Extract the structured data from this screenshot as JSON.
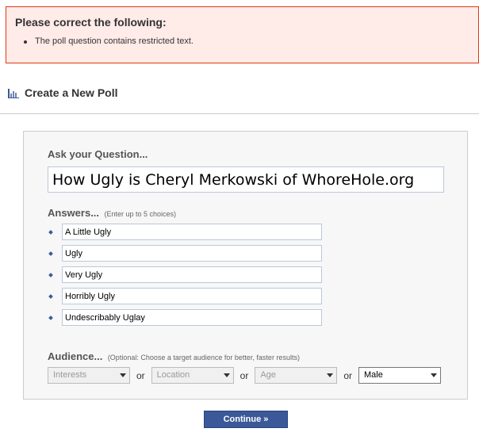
{
  "error": {
    "title": "Please correct the following:",
    "messages": [
      "The poll question contains restricted text."
    ]
  },
  "header": {
    "title": "Create a New Poll",
    "icon": "bar-chart-icon"
  },
  "form": {
    "question": {
      "label": "Ask your Question...",
      "value": "How Ugly is Cheryl Merkowski of WhoreHole.org"
    },
    "answers": {
      "label": "Answers...",
      "hint": "(Enter up to 5 choices)",
      "items": [
        {
          "value": "A Little Ugly"
        },
        {
          "value": "Ugly"
        },
        {
          "value": "Very Ugly"
        },
        {
          "value": "Horribly Ugly"
        },
        {
          "value": "Undescribably Uglay"
        }
      ]
    },
    "audience": {
      "label": "Audience...",
      "hint": "(Optional: Choose a target audience for better, faster results)",
      "separator": "or",
      "selects": [
        {
          "name": "interests",
          "selected": "Interests"
        },
        {
          "name": "location",
          "selected": "Location"
        },
        {
          "name": "age",
          "selected": "Age"
        },
        {
          "name": "gender",
          "selected": "Male"
        }
      ]
    }
  },
  "actions": {
    "continue_label": "Continue »"
  },
  "colors": {
    "error_bg": "#ffebe8",
    "error_border": "#dd3c10",
    "button_bg": "#3b5998",
    "bullet": "#3b5998"
  }
}
